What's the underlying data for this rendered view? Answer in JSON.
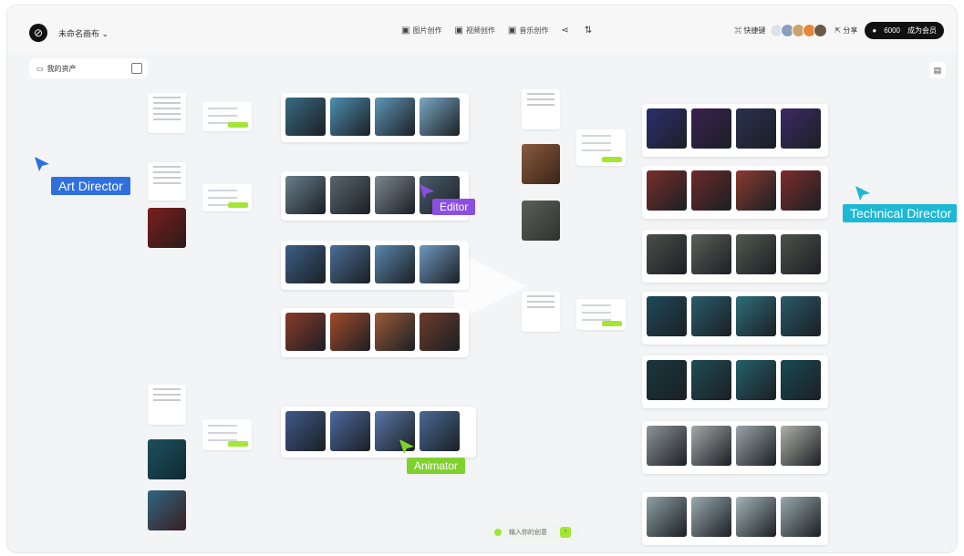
{
  "topbar": {
    "project_name": "未命名画布",
    "tools": [
      "图片创作",
      "视频创作",
      "音乐创作"
    ],
    "shortcut_label": "快捷键",
    "share_label": "分享",
    "credits": "6000",
    "upgrade_label": "成为会员"
  },
  "sidebar": {
    "assets_label": "我的资产"
  },
  "cursors": {
    "art_director": {
      "label": "Art Director",
      "color": "#2f6fde"
    },
    "editor": {
      "label": "Editor",
      "color": "#8b4fe0"
    },
    "technical_director": {
      "label": "Technical Director",
      "color": "#1eb8d4"
    },
    "animator": {
      "label": "Animator",
      "color": "#7fd12d"
    }
  },
  "input": {
    "placeholder": "输入你的创意"
  },
  "palettes": {
    "row_a": [
      "#3b6b84",
      "#4d8fb0",
      "#5f96b8",
      "#7aa8c4"
    ],
    "row_b": [
      "#6a7f8c",
      "#5a6670",
      "#7c8791",
      "#4b5d6a"
    ],
    "row_c": [
      "#3c5f86",
      "#4a6d95",
      "#5a86ad",
      "#6f97be"
    ],
    "row_d": [
      "#8c3a2a",
      "#a44b2a",
      "#9c5a38",
      "#6e3b2a"
    ],
    "row_e": [
      "#3f5a8a",
      "#4d6aa0",
      "#5a78aa",
      "#496a94"
    ],
    "right_1": [
      "#2c2f6e",
      "#3b2050",
      "#2a3150",
      "#3d2a66"
    ],
    "right_2": [
      "#7a2e2a",
      "#6b2a28",
      "#8b3a30",
      "#7e2c2c"
    ],
    "right_3": [
      "#4a5048",
      "#5a6058",
      "#525a50",
      "#4c524a"
    ],
    "right_4": [
      "#1f4a5a",
      "#2a5c6c",
      "#2f6e7c",
      "#2a5a6a"
    ],
    "right_5": [
      "#18383e",
      "#1f4c54",
      "#24606a",
      "#1a4a52"
    ],
    "right_6": [
      "#8e9498",
      "#a4a8a8",
      "#9aa4a8",
      "#b0b0a8"
    ],
    "right_7": [
      "#8ea0a4",
      "#9aaab0",
      "#a4b4b8",
      "#98a8ac"
    ]
  }
}
